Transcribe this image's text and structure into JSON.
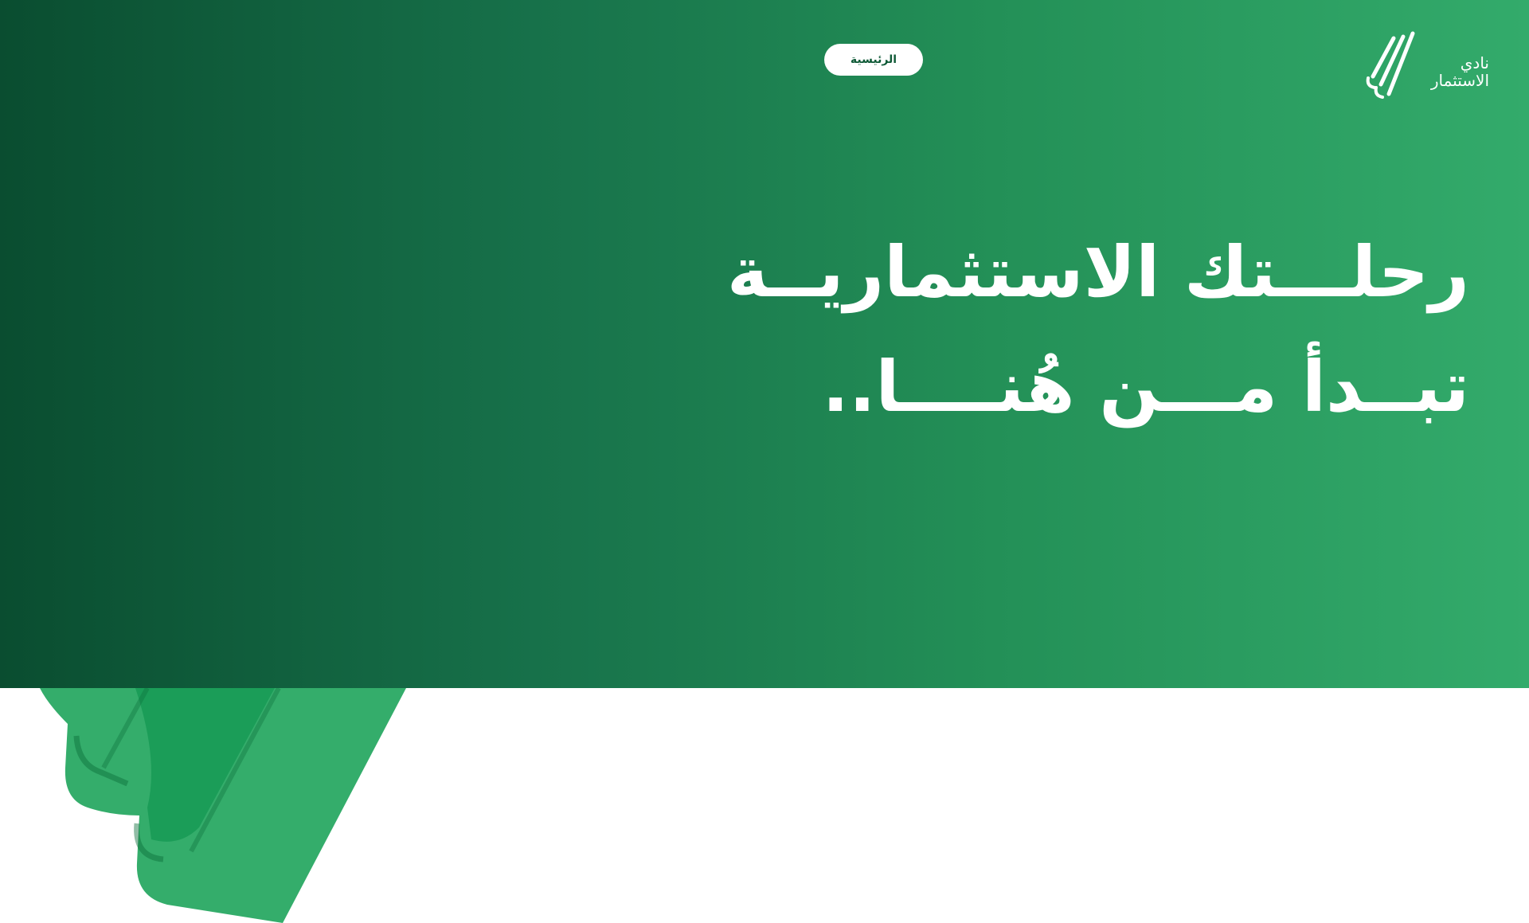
{
  "brand": {
    "name_line1": "نادي",
    "name_line2": "الاستثمار",
    "logo_icon": "triple-slash-logo-icon"
  },
  "nav": {
    "home_label": "الرئيسية"
  },
  "hero": {
    "line1": "رحلـــتك الاستثماريــة",
    "line2": "تبــدأ مـــن هُنــــا.."
  },
  "colors": {
    "gradient_start": "#0a4d30",
    "gradient_end": "#33ab6b",
    "accent_green": "#1fa35c",
    "text_white": "#ffffff",
    "pill_text": "#0f5a37"
  }
}
